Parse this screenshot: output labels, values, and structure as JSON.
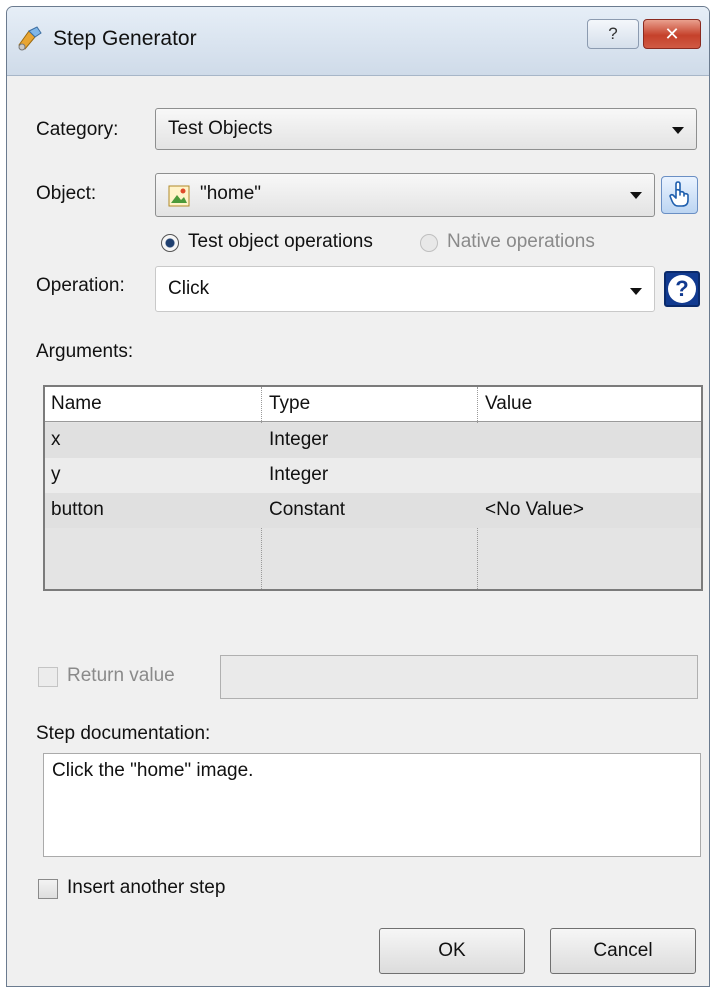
{
  "window": {
    "title": "Step Generator",
    "help_label": "?",
    "close_label": "✕"
  },
  "category": {
    "label": "Category:",
    "value": "Test Objects"
  },
  "object": {
    "label": "Object:",
    "value": "\"home\"",
    "icon": "image-icon"
  },
  "operation_type": {
    "options": [
      "Test object operations",
      "Native operations"
    ],
    "selected": "Test object operations"
  },
  "operation": {
    "label": "Operation:",
    "value": "Click"
  },
  "arguments": {
    "label": "Arguments:",
    "columns": [
      "Name",
      "Type",
      "Value"
    ],
    "rows": [
      [
        "x",
        "Integer",
        ""
      ],
      [
        "y",
        "Integer",
        ""
      ],
      [
        "button",
        "Constant",
        "<No Value>"
      ]
    ]
  },
  "return_value": {
    "label": "Return value",
    "checked": false,
    "enabled": false,
    "value": ""
  },
  "step_documentation": {
    "label": "Step documentation:",
    "text": "Click the \"home\" image."
  },
  "insert_another_step": {
    "label": "Insert another step",
    "checked": false
  },
  "buttons": {
    "ok": "OK",
    "cancel": "Cancel"
  },
  "colors": {
    "dialog_bg": "#f0f0f0",
    "close_red": "#c5412b",
    "help_blue": "#113a90"
  }
}
